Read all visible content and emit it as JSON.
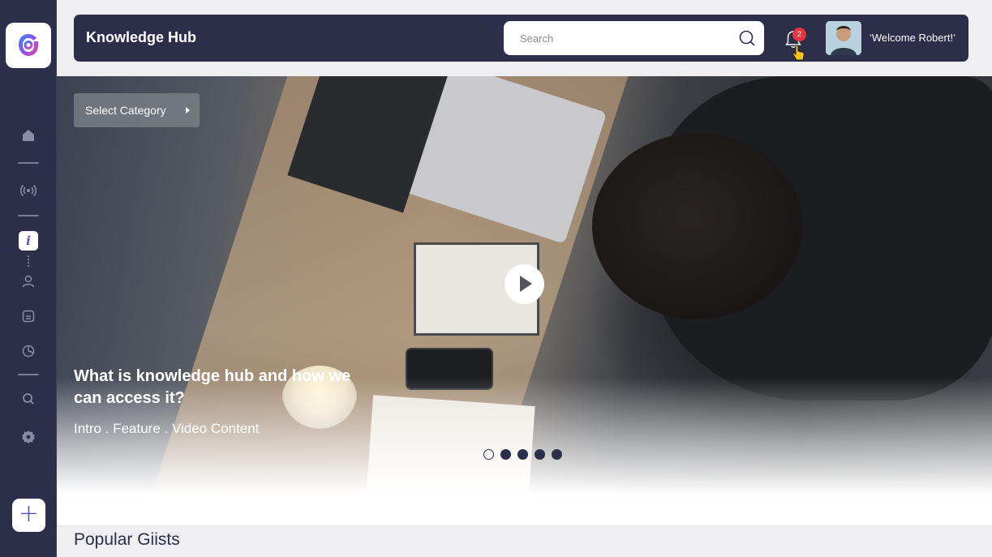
{
  "header": {
    "title": "Knowledge Hub",
    "search_placeholder": "Search",
    "notification_count": "2",
    "welcome_text": "‘Welcome Robert!’"
  },
  "sidebar": {
    "items": [
      {
        "icon": "home-icon"
      },
      {
        "icon": "broadcast-icon"
      },
      {
        "icon": "info-icon",
        "active": true
      },
      {
        "icon": "user-icon"
      },
      {
        "icon": "document-icon"
      },
      {
        "icon": "chart-icon"
      },
      {
        "icon": "search-icon"
      },
      {
        "icon": "settings-icon"
      }
    ],
    "add_label": "+"
  },
  "hero": {
    "category_label": "Select Category",
    "title": "What is knowledge hub and how we can access it?",
    "subtitle": "Intro . Feature . Video Content",
    "slides_total": 5,
    "active_slide": 1
  },
  "section": {
    "title": "Popular Giists"
  },
  "colors": {
    "brand_dark": "#2c2e4a",
    "accent": "#5b4be0",
    "badge": "#e8343f"
  }
}
